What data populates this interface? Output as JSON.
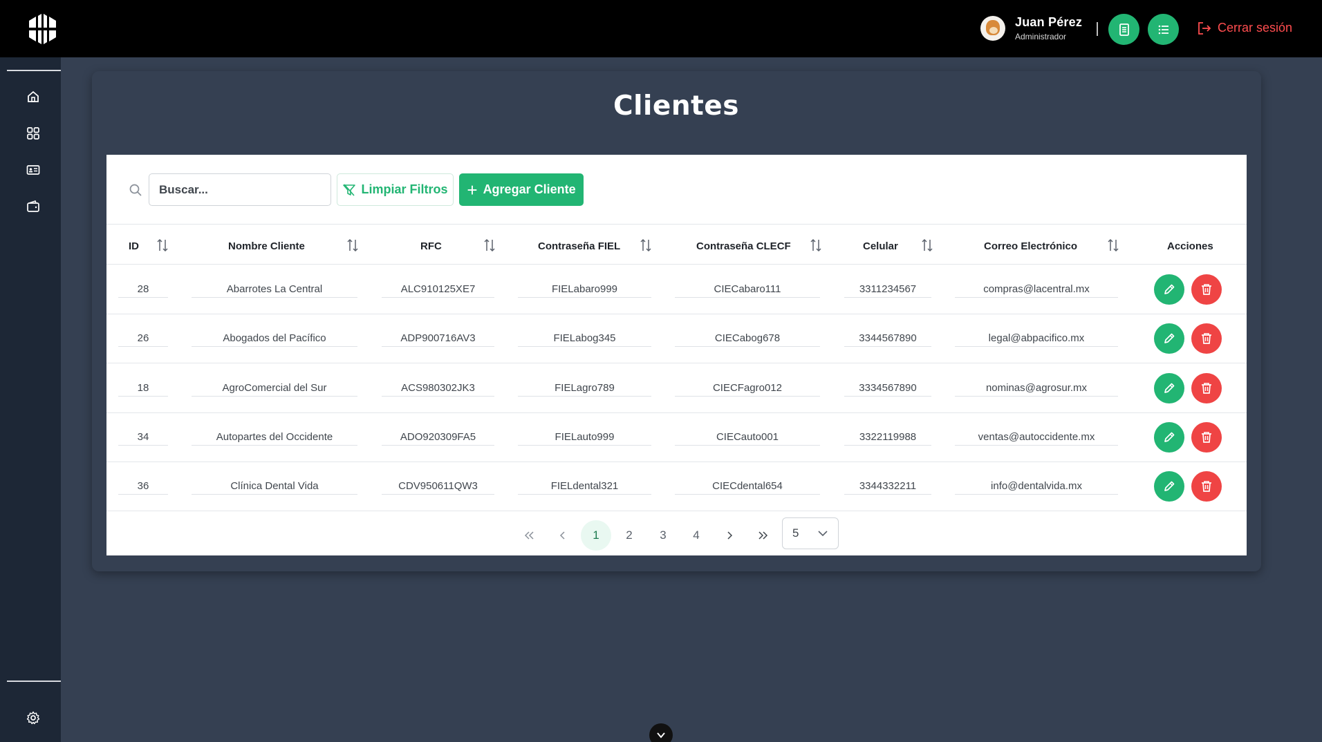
{
  "header": {
    "user_name": "Juan Pérez",
    "user_role": "Administrador",
    "logout_label": "Cerrar sesión"
  },
  "page": {
    "title": "Clientes"
  },
  "toolbar": {
    "search_placeholder": "Buscar...",
    "clear_filters_label": "Limpiar Filtros",
    "add_client_label": "Agregar Cliente"
  },
  "table": {
    "columns": [
      "ID",
      "Nombre Cliente",
      "RFC",
      "Contraseña FIEL",
      "Contraseña CLECF",
      "Celular",
      "Correo Electrónico",
      "Acciones"
    ],
    "rows": [
      [
        "28",
        "Abarrotes La Central",
        "ALC910125XE7",
        "FIELabaro999",
        "CIECabaro111",
        "3311234567",
        "compras@lacentral.mx"
      ],
      [
        "26",
        "Abogados del Pacífico",
        "ADP900716AV3",
        "FIELabog345",
        "CIECabog678",
        "3344567890",
        "legal@abpacifico.mx"
      ],
      [
        "18",
        "AgroComercial del Sur",
        "ACS980302JK3",
        "FIELagro789",
        "CIECFagro012",
        "3334567890",
        "nominas@agrosur.mx"
      ],
      [
        "34",
        "Autopartes del Occidente",
        "ADO920309FA5",
        "FIELauto999",
        "CIECauto001",
        "3322119988",
        "ventas@autoccidente.mx"
      ],
      [
        "36",
        "Clínica Dental Vida",
        "CDV950611QW3",
        "FIELdental321",
        "CIECdental654",
        "3344332211",
        "info@dentalvida.mx"
      ]
    ]
  },
  "pagination": {
    "pages": [
      "1",
      "2",
      "3",
      "4"
    ],
    "current": "1",
    "page_size": "5"
  },
  "colors": {
    "accent": "#22b573",
    "danger": "#ef4444",
    "logout": "#ff4d4f"
  }
}
